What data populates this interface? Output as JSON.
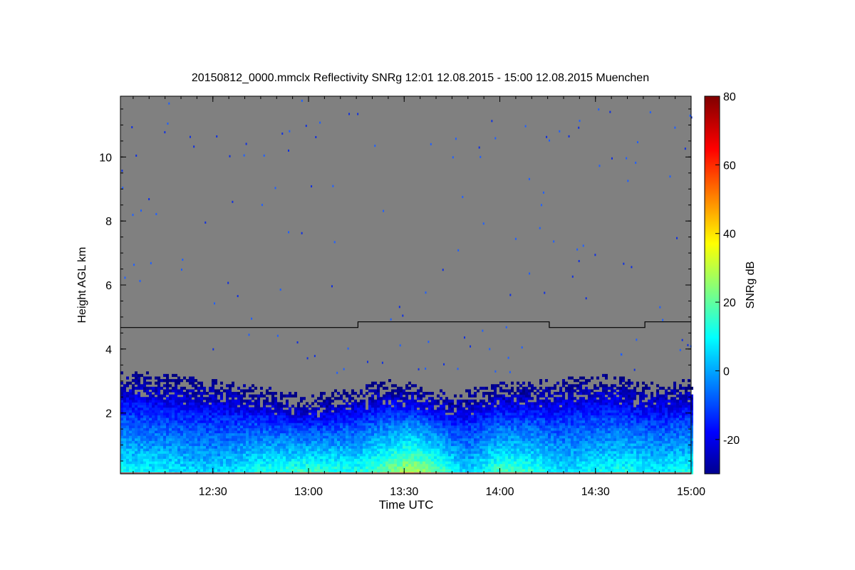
{
  "chart_data": {
    "type": "heatmap",
    "title": "20150812_0000.mmclx Reflectivity SNRg   12:01 12.08.2015 - 15:00 12.08.2015 Muenchen",
    "xlabel": "Time UTC",
    "ylabel": "Height AGL km",
    "colorbar_label": "SNRg dB",
    "x_range_minutes_utc": [
      721,
      900
    ],
    "y_range_km": [
      0.1,
      11.9
    ],
    "x_ticks": [
      {
        "minute": 750,
        "label": "12:30"
      },
      {
        "minute": 780,
        "label": "13:00"
      },
      {
        "minute": 810,
        "label": "13:30"
      },
      {
        "minute": 840,
        "label": "14:00"
      },
      {
        "minute": 870,
        "label": "14:30"
      },
      {
        "minute": 900,
        "label": "15:00"
      }
    ],
    "y_ticks": [
      {
        "value": 2,
        "label": "2"
      },
      {
        "value": 4,
        "label": "4"
      },
      {
        "value": 6,
        "label": "6"
      },
      {
        "value": 8,
        "label": "8"
      },
      {
        "value": 10,
        "label": "10"
      }
    ],
    "colorbar_range_db": [
      -30,
      80
    ],
    "colorbar_ticks": [
      {
        "value": -20,
        "label": "-20"
      },
      {
        "value": 0,
        "label": "0"
      },
      {
        "value": 20,
        "label": "20"
      },
      {
        "value": 40,
        "label": "40"
      },
      {
        "value": 60,
        "label": "60"
      },
      {
        "value": 80,
        "label": "80"
      }
    ],
    "colormap": "jet",
    "background_color": "#808080",
    "boundary_line_km": [
      {
        "from_minute": 721,
        "to_minute": 795.5,
        "height": 4.67
      },
      {
        "from_minute": 795.5,
        "to_minute": 855.5,
        "height": 4.85
      },
      {
        "from_minute": 855.5,
        "to_minute": 885.5,
        "height": 4.67
      },
      {
        "from_minute": 885.5,
        "to_minute": 900,
        "height": 4.85
      }
    ],
    "echo_top_km": [
      {
        "minute": 721,
        "top": 3.1
      },
      {
        "minute": 735,
        "top": 3.0
      },
      {
        "minute": 750,
        "top": 2.8
      },
      {
        "minute": 765,
        "top": 2.6
      },
      {
        "minute": 780,
        "top": 2.3
      },
      {
        "minute": 795,
        "top": 2.6
      },
      {
        "minute": 805,
        "top": 2.8
      },
      {
        "minute": 815,
        "top": 2.7
      },
      {
        "minute": 825,
        "top": 2.4
      },
      {
        "minute": 840,
        "top": 2.7
      },
      {
        "minute": 855,
        "top": 2.8
      },
      {
        "minute": 865,
        "top": 2.9
      },
      {
        "minute": 875,
        "top": 3.0
      },
      {
        "minute": 885,
        "top": 2.7
      },
      {
        "minute": 900,
        "top": 2.8
      }
    ],
    "snr_peak_db": [
      {
        "minute": 721,
        "peak": 12
      },
      {
        "minute": 735,
        "peak": 10
      },
      {
        "minute": 750,
        "peak": 6
      },
      {
        "minute": 765,
        "peak": 14
      },
      {
        "minute": 780,
        "peak": 18
      },
      {
        "minute": 795,
        "peak": 14
      },
      {
        "minute": 805,
        "peak": 24
      },
      {
        "minute": 812,
        "peak": 32
      },
      {
        "minute": 820,
        "peak": 22
      },
      {
        "minute": 830,
        "peak": 6
      },
      {
        "minute": 840,
        "peak": 20
      },
      {
        "minute": 850,
        "peak": 16
      },
      {
        "minute": 860,
        "peak": 8
      },
      {
        "minute": 870,
        "peak": 12
      },
      {
        "minute": 880,
        "peak": 14
      },
      {
        "minute": 890,
        "peak": 10
      },
      {
        "minute": 900,
        "peak": 14
      }
    ]
  }
}
